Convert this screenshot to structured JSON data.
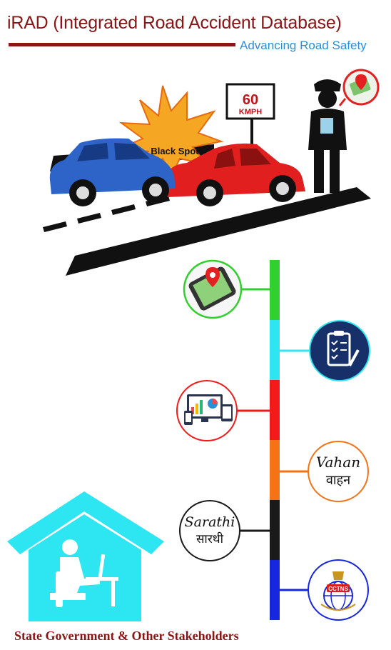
{
  "header": {
    "title": "iRAD (Integrated Road Accident Database)",
    "subtitle": "Advancing Road Safety"
  },
  "scene": {
    "speed_sign_value": "60",
    "speed_sign_unit": "KMPH",
    "black_spot_label": "Black Spot"
  },
  "timeline": {
    "segment_colors": [
      "#31d02e",
      "#2ee6f2",
      "#f41a1a",
      "#f57316",
      "#1a1a1a",
      "#1727e0"
    ],
    "items": [
      {
        "side": "left",
        "icon": "map-phone-icon",
        "border": "#31d02e"
      },
      {
        "side": "right",
        "icon": "checklist-icon",
        "border": "#2ee6f2"
      },
      {
        "side": "left",
        "icon": "analytics-devices-icon",
        "border": "#f41a1a"
      },
      {
        "side": "right",
        "icon": "vahan-logo",
        "border": "#f57316",
        "logo_text": "Vahan",
        "logo_text_hindi": "वाहन"
      },
      {
        "side": "left",
        "icon": "sarathi-logo",
        "border": "#1a1a1a",
        "logo_text": "Sarathi",
        "logo_text_hindi": "सारथी"
      },
      {
        "side": "right",
        "icon": "cctns-logo",
        "border": "#1727e0",
        "logo_text": "CCTNS"
      }
    ]
  },
  "footer": {
    "label": "State Government & Other Stakeholders"
  },
  "colors": {
    "brand_red": "#8b1414",
    "accent_blue": "#2b8fd8",
    "house_cyan": "#2ee6f2",
    "car_blue": "#2e63c7",
    "car_red": "#e21f1f"
  }
}
